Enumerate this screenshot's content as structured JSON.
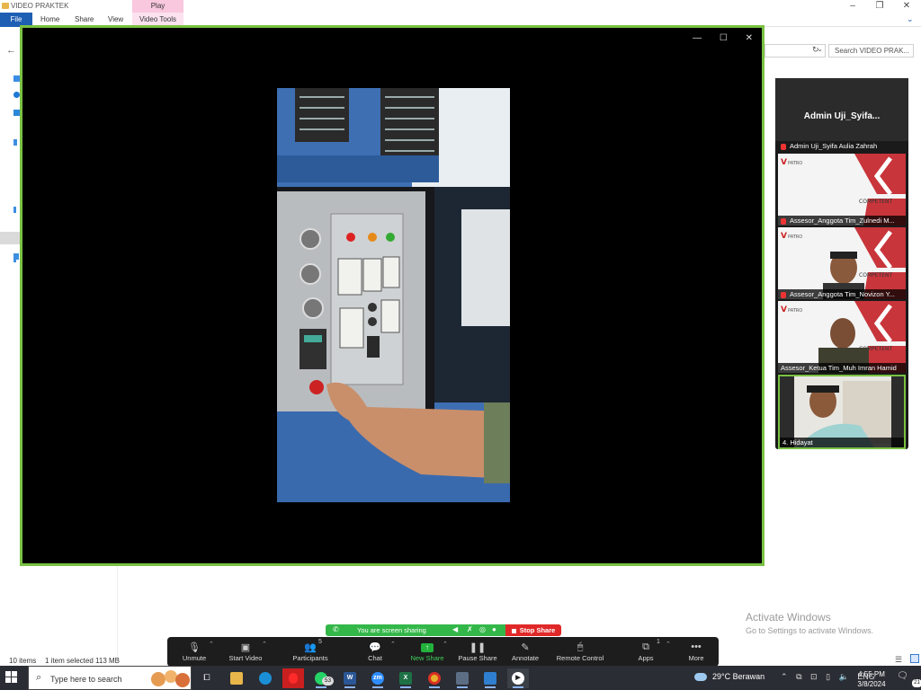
{
  "explorer": {
    "title": "VIDEO PRAKTEK",
    "contextual_tab": "Play",
    "tabs": [
      "File",
      "Home",
      "Share",
      "View"
    ],
    "contextual_group": "Video Tools",
    "search_placeholder": "Search VIDEO PRAK...",
    "status_items": "10 items",
    "status_selected": "1 item selected  113 MB"
  },
  "watermark": {
    "title": "Activate Windows",
    "subtitle": "Go to Settings to activate Windows."
  },
  "gallery": {
    "host_title": "Admin  Uji_Syifa...",
    "participants": [
      {
        "name": "Admin Uji_Syifa Aulia Zahrah",
        "muted": true
      },
      {
        "name": "Assesor_Anggota Tim_Zulnedi M...",
        "muted": true
      },
      {
        "name": "Assesor_Anggota Tim_Novizon Y...",
        "muted": true
      },
      {
        "name": "Assesor_Ketua Tim_Muh Imran Hamid",
        "muted": false
      },
      {
        "name": "4. Hidayat",
        "muted": false
      }
    ],
    "competent_text": "COMPETENT",
    "logo_text": "PATRO"
  },
  "share_bar": {
    "status": "You are screen sharing",
    "stop": "Stop Share"
  },
  "toolbar": {
    "buttons": [
      {
        "label": "Unmute",
        "icon": "mic-muted-icon"
      },
      {
        "label": "Start Video",
        "icon": "video-off-icon"
      },
      {
        "label": "Participants",
        "icon": "participants-icon",
        "count": "5"
      },
      {
        "label": "Chat",
        "icon": "chat-icon"
      },
      {
        "label": "New Share",
        "icon": "share-icon"
      },
      {
        "label": "Pause Share",
        "icon": "pause-icon"
      },
      {
        "label": "Annotate",
        "icon": "pencil-icon"
      },
      {
        "label": "Remote Control",
        "icon": "mouse-icon"
      },
      {
        "label": "Apps",
        "icon": "apps-icon",
        "count": "1"
      },
      {
        "label": "More",
        "icon": "more-icon"
      }
    ]
  },
  "taskbar": {
    "search_placeholder": "Type here to search",
    "whatsapp_badge": "53",
    "weather": "29°C  Berawan",
    "lang": "ENG",
    "time": "4:55 PM",
    "date": "3/8/2024",
    "notifications": "21"
  },
  "colors": {
    "share_border": "#7ac142",
    "share_green": "#34b749",
    "stop_red": "#e02828",
    "taskbar": "#2a2d33",
    "toolbar": "#1d1d1d"
  }
}
